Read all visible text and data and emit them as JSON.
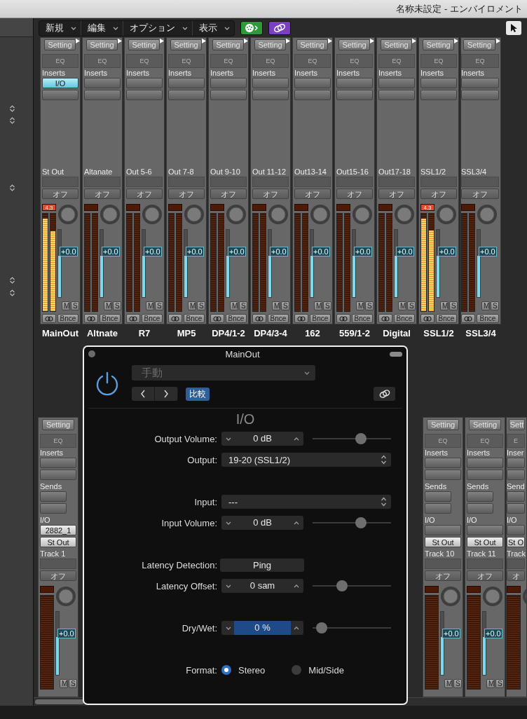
{
  "window": {
    "title": "名称未設定 - エンバイロメント"
  },
  "toolbar": {
    "menus": [
      {
        "label": "新規"
      },
      {
        "label": "編集"
      },
      {
        "label": "オプション"
      },
      {
        "label": "表示"
      }
    ]
  },
  "output_strips": [
    {
      "setting": "Setting",
      "eq": "EQ",
      "inserts_label": "Inserts",
      "inserts": [
        "I/O"
      ],
      "track_label": "St Out",
      "automation": "オフ",
      "peak": "4.3",
      "meters": [
        {
          "level": 0.95
        },
        {
          "level": 0.82
        }
      ],
      "fader": {
        "level": 0.62
      },
      "volume": "+0.0",
      "mute": "M",
      "solo": "S",
      "bounce": "Bnce",
      "name": "MainOut"
    },
    {
      "setting": "Setting",
      "eq": "EQ",
      "inserts_label": "Inserts",
      "track_label": "Altanate",
      "automation": "オフ",
      "meters": [
        {
          "level": 0
        },
        {
          "level": 0
        }
      ],
      "fader": {
        "level": 0.62
      },
      "volume": "+0.0",
      "mute": "M",
      "solo": "S",
      "bounce": "Bnce",
      "name": "Altnate"
    },
    {
      "setting": "Setting",
      "eq": "EQ",
      "inserts_label": "Inserts",
      "track_label": "Out 5-6",
      "automation": "オフ",
      "meters": [
        {
          "level": 0
        },
        {
          "level": 0
        }
      ],
      "fader": {
        "level": 0.62
      },
      "volume": "+0.0",
      "mute": "M",
      "solo": "S",
      "bounce": "Bnce",
      "name": "R7"
    },
    {
      "setting": "Setting",
      "eq": "EQ",
      "inserts_label": "Inserts",
      "track_label": "Out 7-8",
      "automation": "オフ",
      "meters": [
        {
          "level": 0
        },
        {
          "level": 0
        }
      ],
      "fader": {
        "level": 0.62
      },
      "volume": "+0.0",
      "mute": "M",
      "solo": "S",
      "bounce": "Bnce",
      "name": "MP5"
    },
    {
      "setting": "Setting",
      "eq": "EQ",
      "inserts_label": "Inserts",
      "track_label": "Out 9-10",
      "automation": "オフ",
      "meters": [
        {
          "level": 0
        },
        {
          "level": 0
        }
      ],
      "fader": {
        "level": 0.62
      },
      "volume": "+0.0",
      "mute": "M",
      "solo": "S",
      "bounce": "Bnce",
      "name": "DP4/1-2"
    },
    {
      "setting": "Setting",
      "eq": "EQ",
      "inserts_label": "Inserts",
      "track_label": "Out 11-12",
      "automation": "オフ",
      "meters": [
        {
          "level": 0
        },
        {
          "level": 0
        }
      ],
      "fader": {
        "level": 0.62
      },
      "volume": "+0.0",
      "mute": "M",
      "solo": "S",
      "bounce": "Bnce",
      "name": "DP4/3-4"
    },
    {
      "setting": "Setting",
      "eq": "EQ",
      "inserts_label": "Inserts",
      "track_label": "Out13-14",
      "automation": "オフ",
      "meters": [
        {
          "level": 0
        },
        {
          "level": 0
        }
      ],
      "fader": {
        "level": 0.62
      },
      "volume": "+0.0",
      "mute": "M",
      "solo": "S",
      "bounce": "Bnce",
      "name": "162"
    },
    {
      "setting": "Setting",
      "eq": "EQ",
      "inserts_label": "Inserts",
      "track_label": "Out15-16",
      "automation": "オフ",
      "meters": [
        {
          "level": 0
        },
        {
          "level": 0
        }
      ],
      "fader": {
        "level": 0.62
      },
      "volume": "+0.0",
      "mute": "M",
      "solo": "S",
      "bounce": "Bnce",
      "name": "559/1-2"
    },
    {
      "setting": "Setting",
      "eq": "EQ",
      "inserts_label": "Inserts",
      "track_label": "Out17-18",
      "automation": "オフ",
      "meters": [
        {
          "level": 0
        },
        {
          "level": 0
        }
      ],
      "fader": {
        "level": 0.62
      },
      "volume": "+0.0",
      "mute": "M",
      "solo": "S",
      "bounce": "Bnce",
      "name": "Digital"
    },
    {
      "setting": "Setting",
      "eq": "EQ",
      "inserts_label": "Inserts",
      "track_label": "SSL1/2",
      "automation": "オフ",
      "peak": "4.3",
      "meters": [
        {
          "level": 0.95
        },
        {
          "level": 0.83
        }
      ],
      "fader": {
        "level": 0.62
      },
      "volume": "+0.0",
      "mute": "M",
      "solo": "S",
      "bounce": "Bnce",
      "name": "SSL1/2"
    },
    {
      "setting": "Setting",
      "eq": "EQ",
      "inserts_label": "Inserts",
      "track_label": "SSL3/4",
      "automation": "オフ",
      "meters": [
        {
          "level": 0
        },
        {
          "level": 0
        }
      ],
      "fader": {
        "level": 0.62
      },
      "volume": "+0.0",
      "mute": "M",
      "solo": "S",
      "bounce": "Bnce",
      "name": "SSL3/4"
    }
  ],
  "track_strips": [
    {
      "setting": "Setting",
      "eq": "EQ",
      "inserts_label": "Inserts",
      "sends_label": "Sends",
      "io_label": "I/O",
      "input": "2882_1",
      "output": "St Out",
      "track_label": "Track 1",
      "automation": "オフ",
      "meters": [
        {
          "level": 0
        }
      ],
      "fader": {
        "level": 0.6
      },
      "volume": "+0.0",
      "mute": "M",
      "solo": "S"
    },
    {
      "setting": "Setting",
      "eq": "EQ",
      "inserts_label": "Inserts",
      "sends_label": "Sends",
      "io_label": "I/O",
      "output": "St Out",
      "track_label": "Track 10",
      "automation": "オフ",
      "meters": [
        {
          "level": 0
        }
      ],
      "fader": {
        "level": 0.6
      },
      "volume": "+0.0",
      "mute": "M",
      "solo": "S"
    },
    {
      "setting": "Setting",
      "eq": "EQ",
      "inserts_label": "Inserts",
      "sends_label": "Sends",
      "io_label": "I/O",
      "output": "St Out",
      "track_label": "Track 11",
      "automation": "オフ",
      "meters": [
        {
          "level": 0
        }
      ],
      "fader": {
        "level": 0.6
      },
      "volume": "+0.0",
      "mute": "M",
      "solo": "S"
    },
    {
      "setting": "Sett",
      "eq": "E",
      "inserts_label": "Inser",
      "sends_label": "Send",
      "io_label": "I/O",
      "output": "St O",
      "track_label": "Track",
      "automation": "オ",
      "meters": [
        {
          "level": 0
        }
      ]
    }
  ],
  "plugin": {
    "title": "MainOut",
    "power": {
      "on": true
    },
    "preset": "手動",
    "compare": "比較",
    "heading": "I/O",
    "groups": [
      {
        "params": [
          {
            "kind": "stepper",
            "label": "Output Volume:",
            "value": "0 dB",
            "selected": false,
            "level": 0.64
          },
          {
            "kind": "popup",
            "label": "Output:",
            "value": "19-20 (SSL1/2)"
          }
        ]
      },
      {
        "params": [
          {
            "kind": "popup",
            "label": "Input:",
            "value": "---"
          },
          {
            "kind": "stepper",
            "label": "Input Volume:",
            "value": "0 dB",
            "selected": false,
            "level": 0.64
          }
        ]
      },
      {
        "params": [
          {
            "kind": "button",
            "label": "Latency Detection:",
            "value": "Ping"
          },
          {
            "kind": "stepper",
            "label": "Latency Offset:",
            "value": "0 sam",
            "selected": false,
            "level": 0.35
          }
        ]
      },
      {
        "params": [
          {
            "kind": "stepper",
            "label": "Dry/Wet:",
            "value": "0 %",
            "selected": true,
            "level": 0.05
          }
        ]
      },
      {
        "params": [
          {
            "kind": "radio",
            "label": "Format:",
            "options": [
              {
                "label": "Stereo",
                "selected": true
              },
              {
                "label": "Mid/Side",
                "selected": false
              }
            ]
          }
        ]
      }
    ]
  }
}
